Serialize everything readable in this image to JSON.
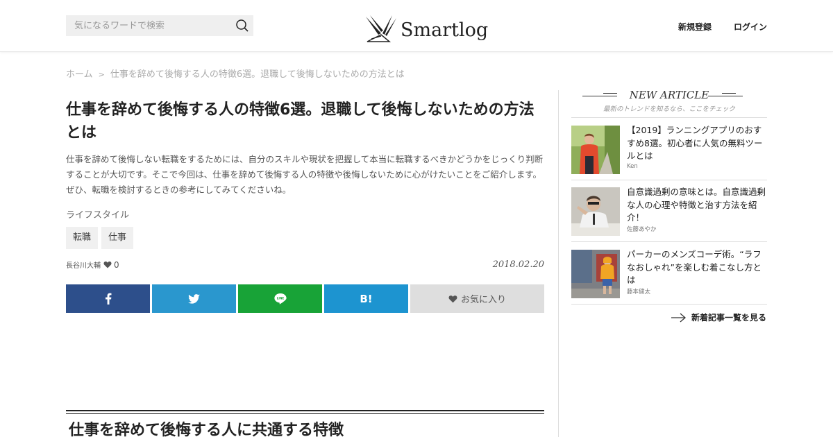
{
  "header": {
    "search_placeholder": "気になるワードで検索",
    "logo_text": "Smartlog",
    "register": "新規登録",
    "login": "ログイン"
  },
  "breadcrumb": {
    "home": "ホーム",
    "separator": ">",
    "current": "仕事を辞めて後悔する人の特徴6選。退職して後悔しないための方法とは"
  },
  "article": {
    "title": "仕事を辞めて後悔する人の特徴6選。退職して後悔しないための方法とは",
    "lead": "仕事を辞めて後悔しない転職をするためには、自分のスキルや現状を把握して本当に転職するべきかどうかをじっくり判断することが大切です。そこで今回は、仕事を辞めて後悔する人の特徴や後悔しないために心がけたいことをご紹介します。ぜひ、転職を検討するときの参考にしてみてくださいね。",
    "category": "ライフスタイル",
    "tags": [
      "転職",
      "仕事"
    ],
    "author": "長谷川大輔",
    "likes": "0",
    "date": "2018.02.20",
    "share": {
      "hatena": "B!",
      "favorite": "お気に入り"
    },
    "section_heading": "仕事を辞めて後悔する人に共通する特徴"
  },
  "sidebar": {
    "heading": "NEW ARTICLE",
    "subheading": "最新のトレンドを知るなら、ここをチェック",
    "items": [
      {
        "title": "【2019】ランニングアプリのおすすめ8選。初心者に人気の無料ツールとは",
        "author": "Ken"
      },
      {
        "title": "自意識過剰の意味とは。自意識過剰な人の心理や特徴と治す方法を紹介！",
        "author": "佐藤あやか"
      },
      {
        "title": "パーカーのメンズコーデ術。“ラフなおしゃれ”を楽しむ着こなし方とは",
        "author": "藤本健太"
      }
    ],
    "more": "新着記事一覧を見る"
  },
  "colors": {
    "facebook": "#2d4f8b",
    "twitter": "#2a97ce",
    "line": "#18a337",
    "hatena": "#1d94d0",
    "favorite_bg": "#dedede"
  },
  "icons": [
    "search-icon",
    "logo-bird-icon",
    "heart-icon",
    "facebook-icon",
    "twitter-icon",
    "line-icon",
    "arrow-right-icon"
  ]
}
